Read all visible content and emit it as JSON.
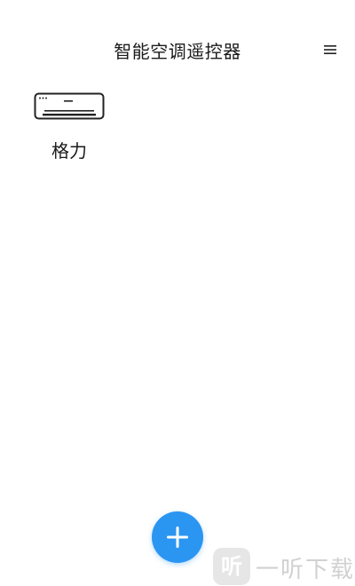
{
  "header": {
    "title": "智能空调遥控器",
    "menu_icon": "menu-icon"
  },
  "devices": [
    {
      "label": "格力",
      "icon": "air-conditioner-icon"
    }
  ],
  "fab": {
    "icon": "plus-icon",
    "color": "#2b95f2"
  },
  "watermark": {
    "logo_glyph": "听",
    "text": "一听下载"
  }
}
